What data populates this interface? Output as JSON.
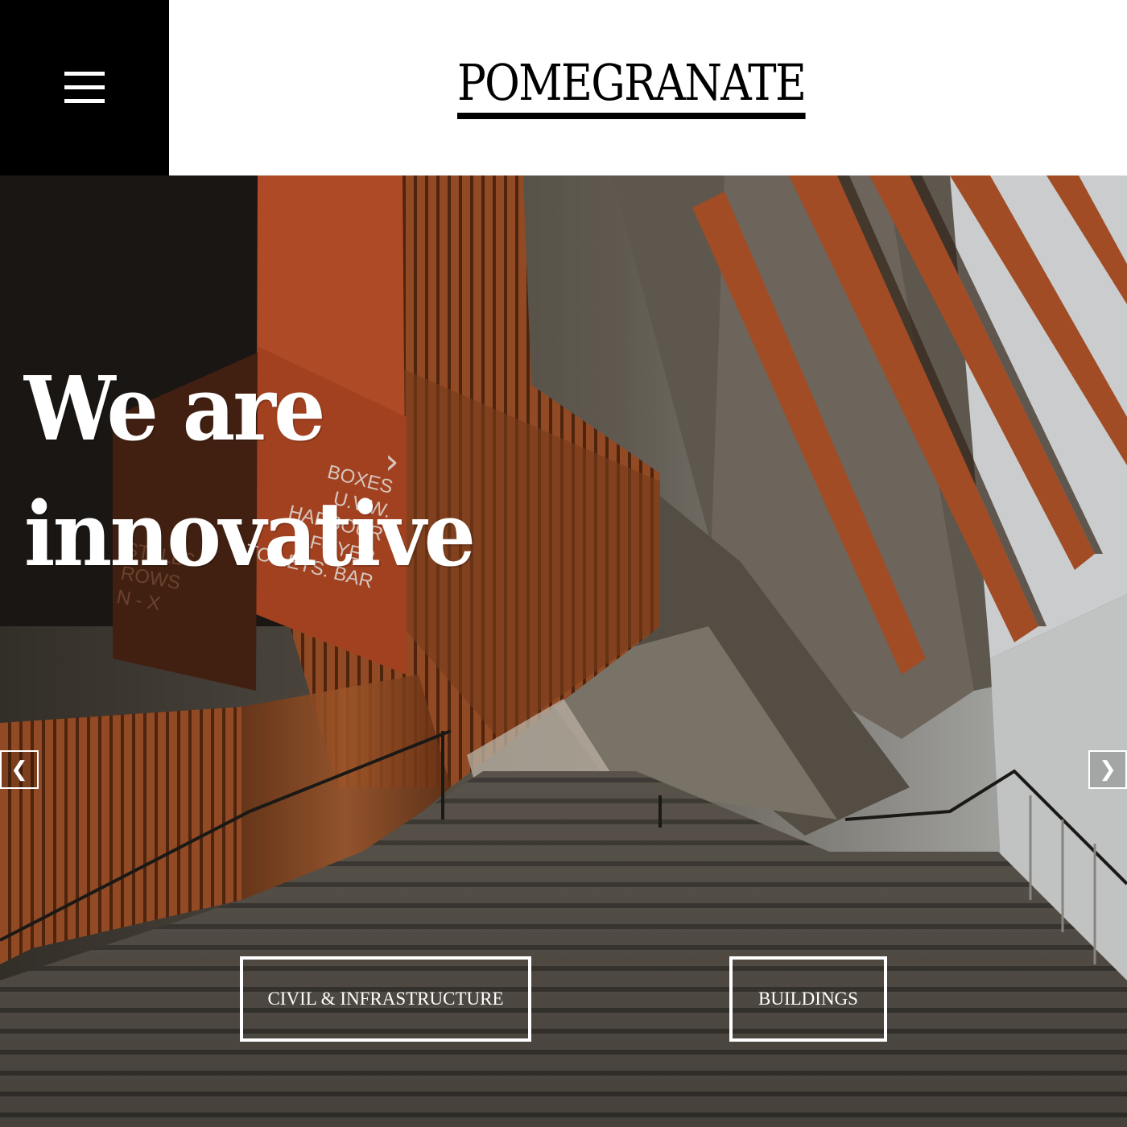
{
  "header": {
    "menu_icon": "hamburger-menu-icon",
    "logo": "POMEGRANATE"
  },
  "hero": {
    "headline_line1": "We are",
    "headline_line2": "innovative",
    "carousel": {
      "prev_label": "❮",
      "next_label": "❯",
      "prev_icon": "chevron-left-icon",
      "next_icon": "chevron-right-icon"
    },
    "sign_text": [
      "STALLS",
      "ROWS",
      "N - X",
      "BOXES",
      "U.V.W.",
      "HARBOUR",
      "FOYER",
      "TOILETS. BAR"
    ],
    "buttons": {
      "civil": "CIVIL & INFRASTRUCTURE",
      "buildings": "BUILDINGS"
    }
  },
  "colors": {
    "menu_block": "#000000",
    "header_bg": "#ffffff",
    "accent_orange": "#c8552d",
    "wood": "#a9582a",
    "concrete": "#6e675d",
    "text_light": "#ffffff"
  }
}
